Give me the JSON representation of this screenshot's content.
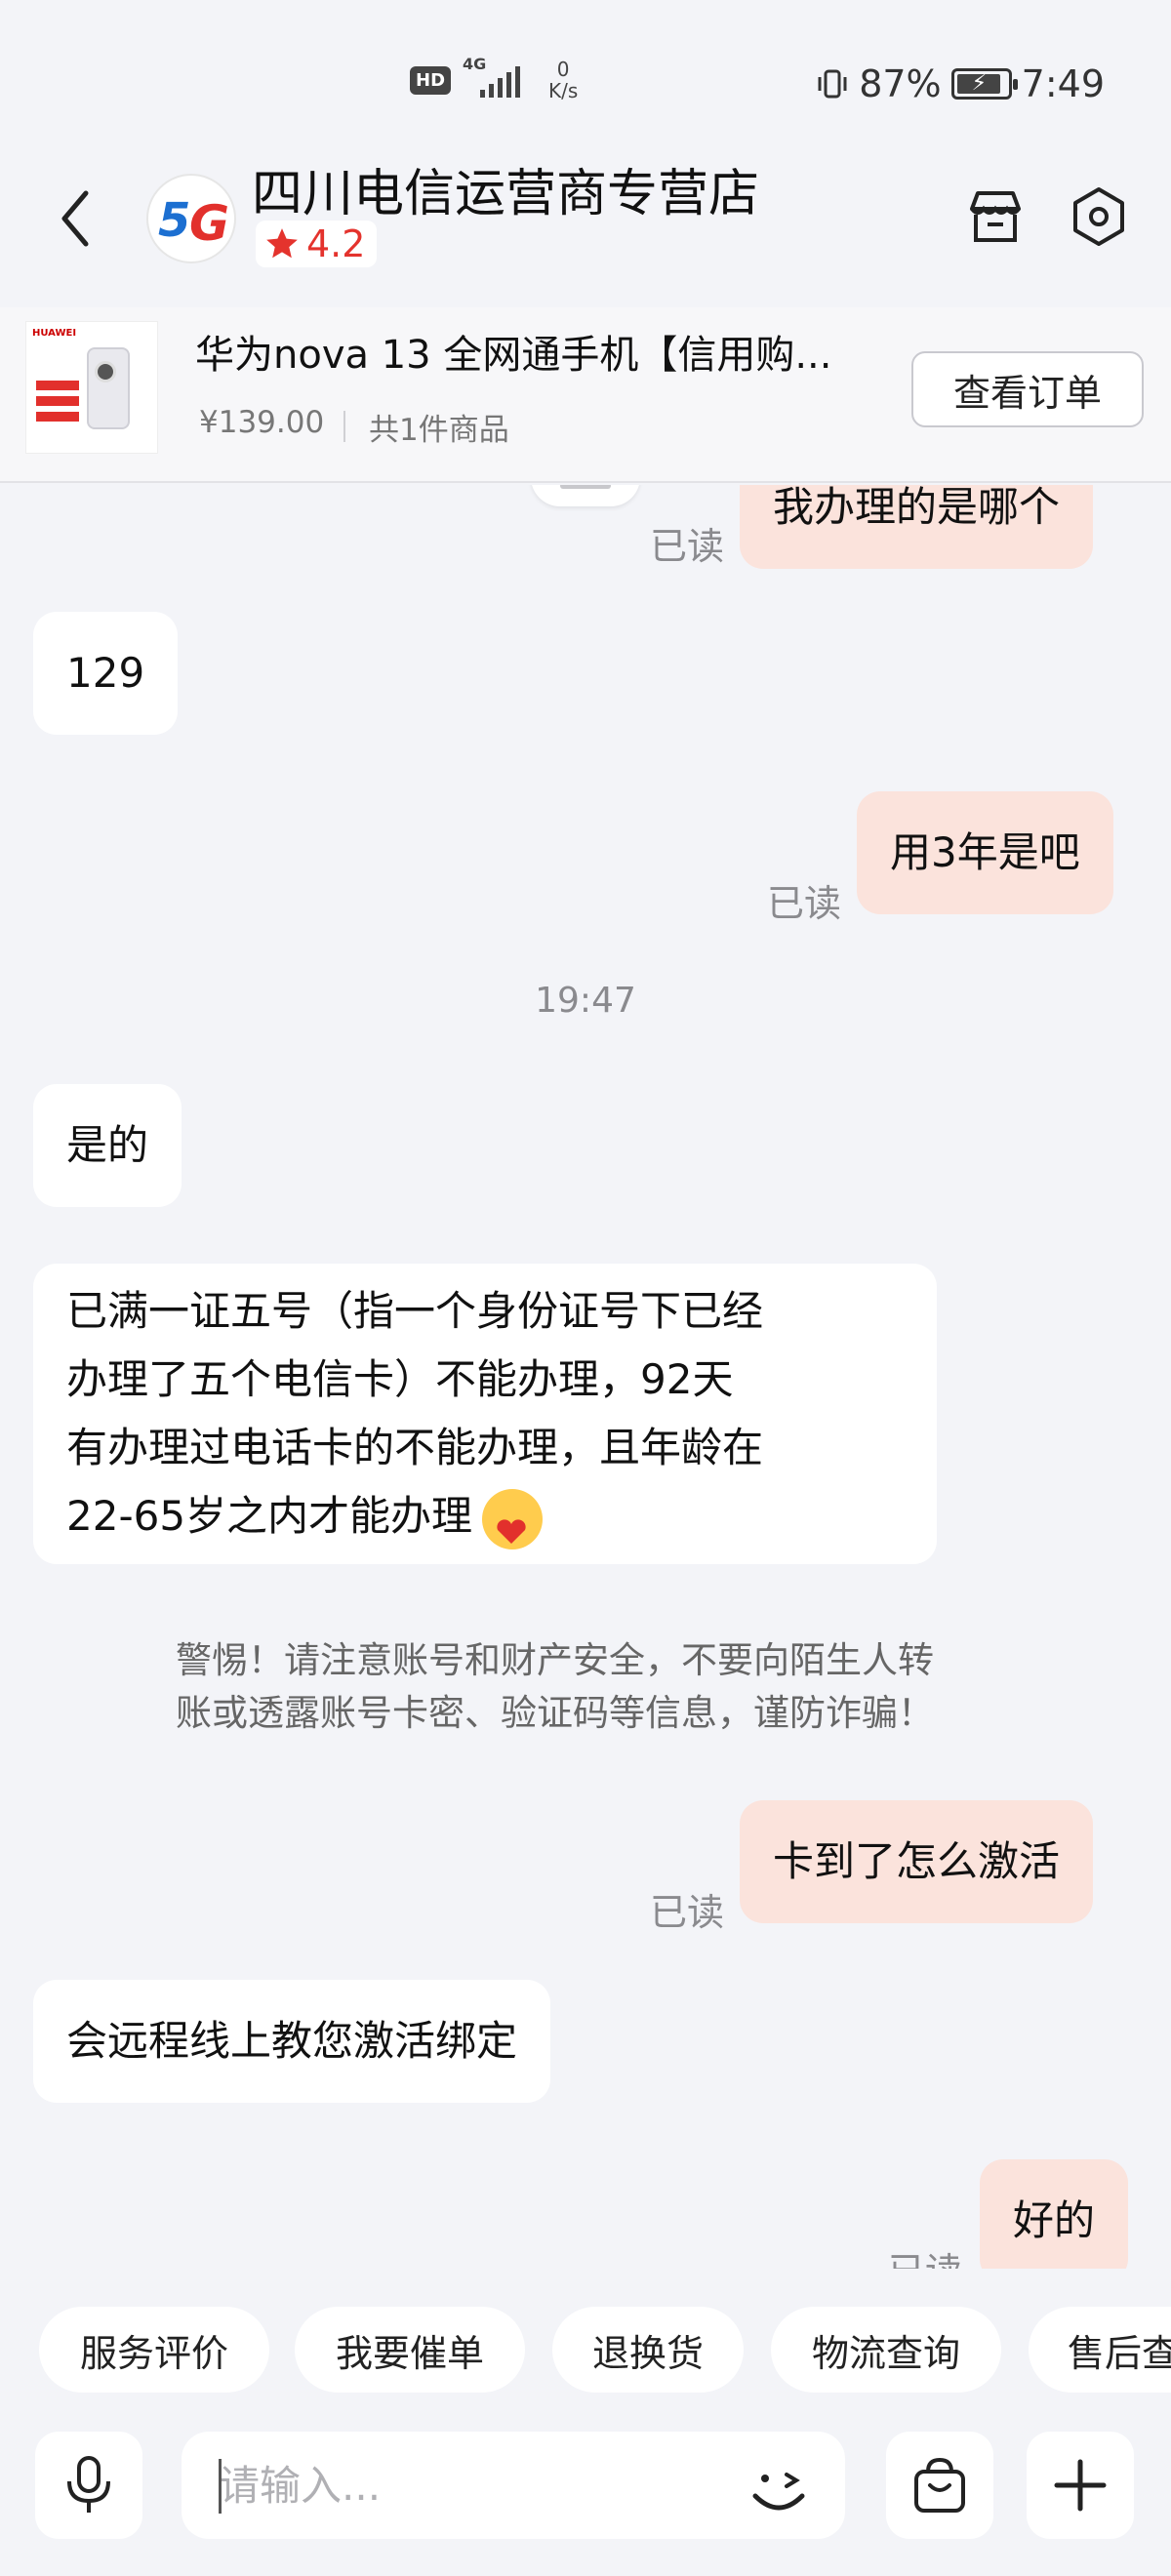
{
  "status_bar": {
    "hd": "HD",
    "network": "4G",
    "speed_value": "0",
    "speed_unit": "K/s",
    "battery": "87%",
    "time": "7:49",
    "battery_level": 0.87
  },
  "header": {
    "back_icon": "chevron-left-icon",
    "avatar_text_5": "5",
    "avatar_text_g": "G",
    "shop_name": "四川电信运营商专营店",
    "rating": "4.2",
    "rating_color": "#e4332d",
    "store_icon": "store-icon",
    "settings_icon": "settings-hexagon-icon"
  },
  "product": {
    "thumb_brand": "HUAWEI",
    "name": "华为nova 13 全网通手机【信用购...",
    "price": "¥139.00",
    "count": "共1件商品",
    "view_order_label": "查看订单"
  },
  "messages": [
    {
      "side": "right",
      "text": "我办理的是哪个",
      "read": "已读"
    },
    {
      "side": "left",
      "text": "129"
    },
    {
      "side": "right",
      "text": "用3年是吧",
      "read": "已读"
    },
    {
      "type": "time",
      "text": "19:47"
    },
    {
      "side": "left",
      "text": "是的"
    },
    {
      "side": "left",
      "lines": [
        "已满一证五号（指一个身份证号下已经",
        "办理了五个电信卡）不能办理，92天",
        "有办理过电话卡的不能办理，且年龄在",
        "22-65岁之内才能办理"
      ],
      "emoji": "hugging-face-emoji"
    },
    {
      "type": "warning",
      "lines": [
        "警惕！请注意账号和财产安全，不要向陌生人转",
        "账或透露账号卡密、验证码等信息，谨防诈骗！"
      ]
    },
    {
      "side": "right",
      "text": "卡到了怎么激活",
      "read": "已读"
    },
    {
      "side": "left",
      "text": "会远程线上教您激活绑定"
    },
    {
      "side": "right",
      "text": "好的",
      "read": "已读"
    }
  ],
  "quick_actions": [
    "服务评价",
    "我要催单",
    "退换货",
    "物流查询",
    "售后查"
  ],
  "input": {
    "placeholder": "请输入...",
    "mic_icon": "microphone-icon",
    "emoji_icon": "emoji-icon",
    "bag_icon": "shopping-bag-icon",
    "plus_icon": "plus-icon"
  },
  "colors": {
    "background": "#f3f4f8",
    "bubble_self": "#fbe3dc",
    "bubble_other": "#ffffff",
    "accent_red": "#e4332d"
  }
}
